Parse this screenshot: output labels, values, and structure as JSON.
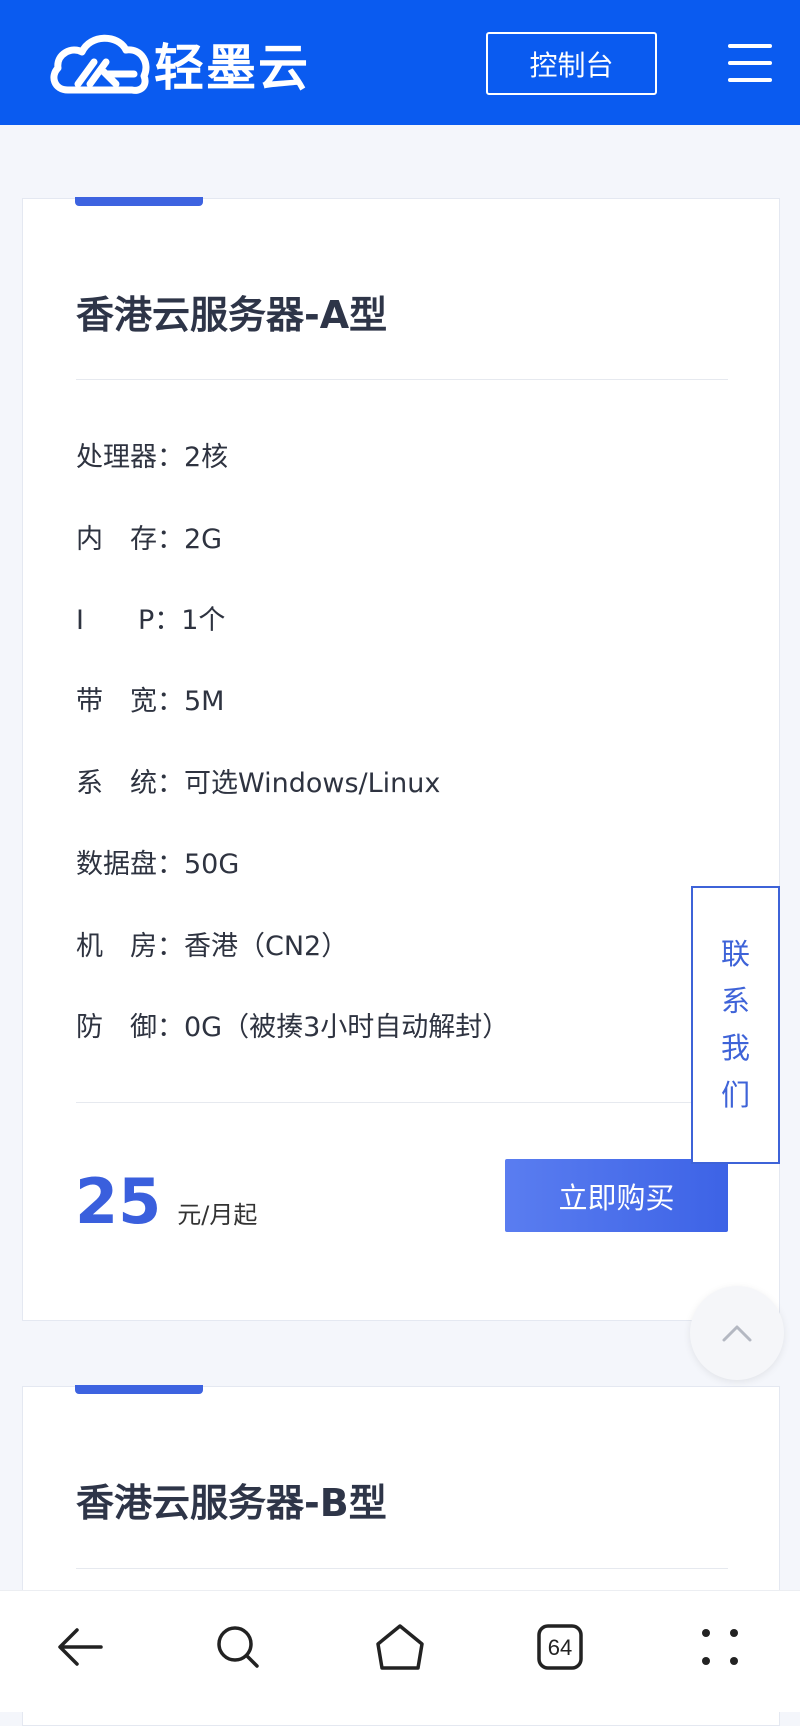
{
  "header": {
    "logo_text": "轻墨云",
    "console_label": "控制台",
    "menu_icon": "hamburger-menu-icon",
    "bg_color": "#0a5bf0"
  },
  "card_a": {
    "title": "香港云服务器-A型",
    "specs": [
      "处理器：2核",
      "内　存：2G",
      "I　　P：1个",
      "带　宽：5M",
      "系　统：可选Windows/Linux",
      "数据盘：50G",
      "机　房：香港（CN2）",
      "防　御：0G（被揍3小时自动解封）"
    ],
    "price": "25",
    "price_unit": "元/月起",
    "buy_label": "立即购买",
    "accent_color": "#3d63e0"
  },
  "card_b": {
    "title": "香港云服务器-B型"
  },
  "floating": {
    "contact_chars": [
      "联",
      "系",
      "我",
      "们"
    ],
    "back_to_top_icon": "chevron-up-icon"
  },
  "bottom_nav": {
    "icons": [
      "back-arrow-icon",
      "search-icon",
      "home-icon",
      "tabs-icon",
      "more-dots-icon"
    ],
    "tab_count": "64"
  }
}
